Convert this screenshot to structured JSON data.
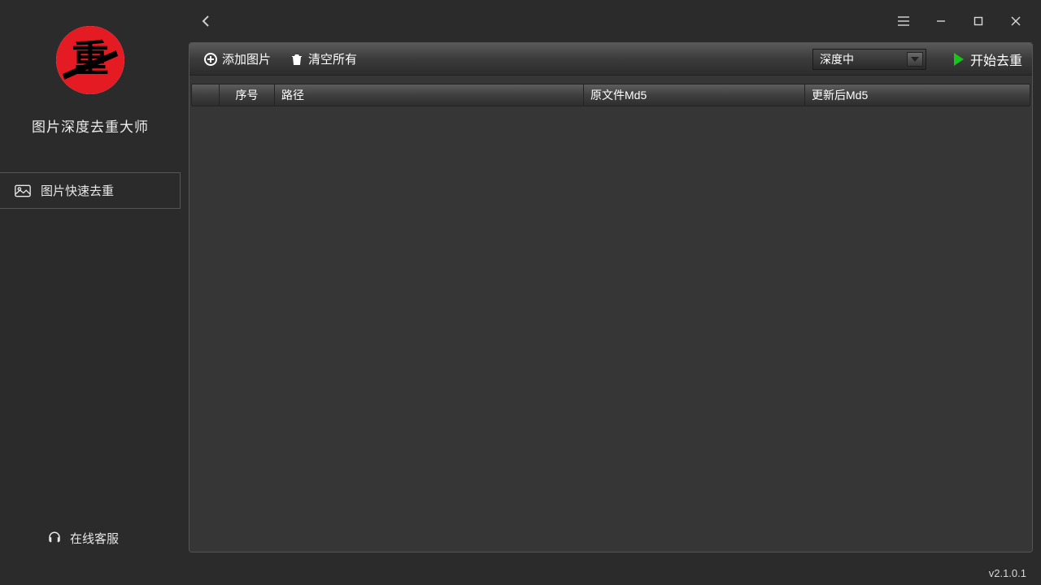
{
  "brand": {
    "title": "图片深度去重大师",
    "glyph": "重"
  },
  "sidebar": {
    "items": [
      {
        "label": "图片快速去重"
      }
    ],
    "support_label": "在线客服"
  },
  "toolbar": {
    "add_label": "添加图片",
    "clear_label": "清空所有",
    "depth_selected": "深度中",
    "run_label": "开始去重"
  },
  "table": {
    "columns": {
      "seq": "序号",
      "path": "路径",
      "orig_md5": "原文件Md5",
      "new_md5": "更新后Md5"
    },
    "rows": []
  },
  "footer": {
    "version": "v2.1.0.1"
  }
}
